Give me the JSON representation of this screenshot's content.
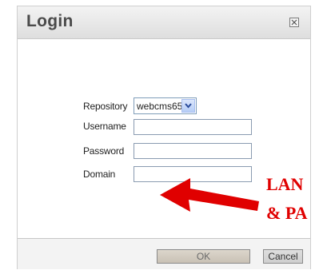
{
  "dialog": {
    "title": "Login",
    "close_icon": "close-x-icon"
  },
  "form": {
    "repository": {
      "label": "Repository",
      "value": "webcms65"
    },
    "username": {
      "label": "Username",
      "value": ""
    },
    "password": {
      "label": "Password",
      "value": ""
    },
    "domain": {
      "label": "Domain",
      "value": ""
    }
  },
  "footer": {
    "ok_label": "OK",
    "cancel_label": "Cancel"
  },
  "annotation": {
    "line1": "LAN",
    "line2": "& PA",
    "color": "#e00000",
    "arrow_icon": "red-arrow-left-icon"
  }
}
